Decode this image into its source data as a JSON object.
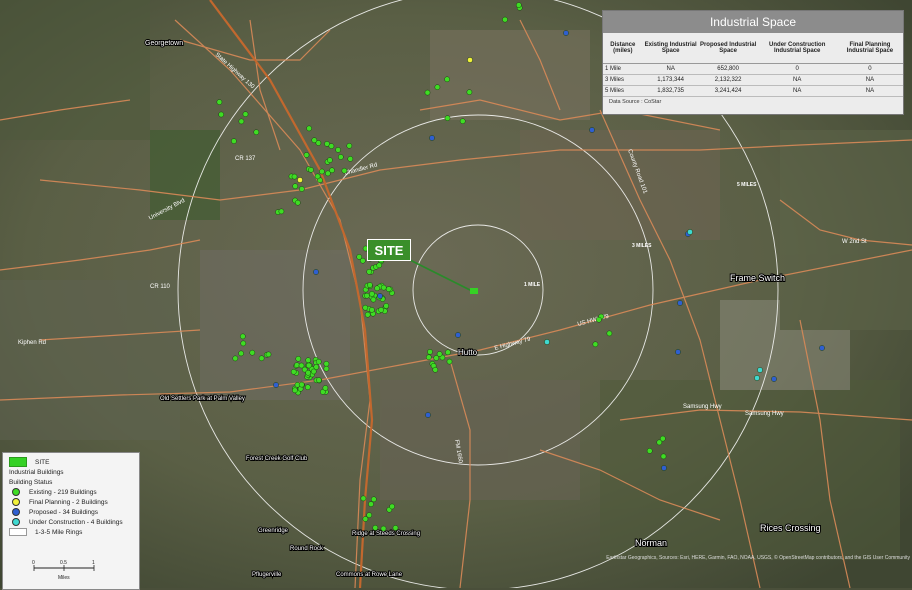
{
  "site_label": "SITE",
  "place_names": {
    "frame_switch": "Frame Switch",
    "rices_crossing": "Rices Crossing",
    "norman": "Norman",
    "hutto": "Hutto",
    "georgetown": "Georgetown",
    "forest_creek": "Forest Creek Golf Club",
    "ridge_at_steeds": "Ridge at Steeds Crossing",
    "greenridge": "Greenridge",
    "pflugerville": "Pflugerville",
    "commons_at_rowe": "Commons at Rowe Lane",
    "old_settlers": "Old Settlers Park at Palm Valley",
    "round_rock": "Round Rock"
  },
  "road_names": {
    "state_highway_130": "State Highway 130",
    "university_blvd": "University Blvd",
    "chandler_rd": "Chandler Rd",
    "e_highway_79": "E Highway 79",
    "us_hwy_79": "US HWY 79",
    "samsung_hwy": "Samsung Hwy",
    "county_road_101": "County Road 101",
    "w_2nd_st": "W 2nd St",
    "kiphen_rd": "Kiphen Rd",
    "cr_110": "CR 110",
    "cr_137": "CR 137",
    "fm_1660": "FM 1660"
  },
  "ring_labels": [
    "1 MILE",
    "3 MILES",
    "5 MILES"
  ],
  "table": {
    "title": "Industrial Space",
    "headers": [
      "Distance (miles)",
      "Existing Industrial Space",
      "Proposed Industrial Space",
      "Under Construction Industrial Space",
      "Final Planning Industrial Space"
    ],
    "rows": [
      [
        "1 Mile",
        "NA",
        "652,800",
        "0",
        "0"
      ],
      [
        "3 Miles",
        "1,173,344",
        "2,132,322",
        "NA",
        "NA"
      ],
      [
        "5 Miles",
        "1,832,735",
        "3,241,424",
        "NA",
        "NA"
      ]
    ],
    "source": "Data Source : CoStar"
  },
  "legend": {
    "site": "SITE",
    "industrial_buildings": "Industrial Buildings",
    "building_status": "Building Status",
    "existing": "Existing - 219 Buildings",
    "final_planning": "Final Planning - 2 Buildings",
    "proposed": "Proposed - 34 Buildings",
    "under_construction": "Under Construction - 4 Buildings",
    "rings": "1-3-5 Mile Rings"
  },
  "scale": {
    "t0": "0",
    "t1": "0.5",
    "t2": "1",
    "unit": "Miles"
  },
  "attribution": "Earthstar Geographics, Sources: Esri, HERE, Garmin, FAO, NOAA, USGS, © OpenStreetMap contributors, and the GIS User Community",
  "colors": {
    "existing": "#3fdc24",
    "final_planning": "#f2f23a",
    "proposed": "#2f5fd0",
    "under_construction": "#3fd9d0",
    "road": "#d98a58",
    "ring": "#ffffff"
  },
  "icons": {
    "north_arrow": "north-arrow-icon"
  }
}
